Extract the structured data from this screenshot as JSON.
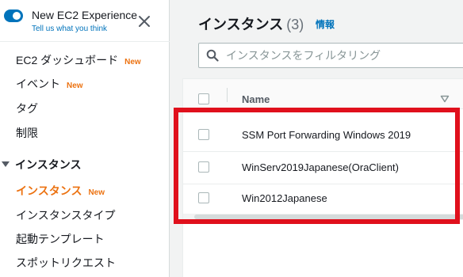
{
  "experience": {
    "title": "New EC2 Experience",
    "link": "Tell us what you think"
  },
  "sidebar": {
    "items": [
      {
        "label": "EC2 ダッシュボード",
        "badge": "New"
      },
      {
        "label": "イベント",
        "badge": "New"
      },
      {
        "label": "タグ",
        "badge": ""
      },
      {
        "label": "制限",
        "badge": ""
      }
    ],
    "section": {
      "label": "インスタンス",
      "items": [
        {
          "label": "インスタンス",
          "badge": "New",
          "active": true
        },
        {
          "label": "インスタンスタイプ",
          "badge": ""
        },
        {
          "label": "起動テンプレート",
          "badge": ""
        },
        {
          "label": "スポットリクエスト",
          "badge": ""
        }
      ]
    }
  },
  "main": {
    "title": "インスタンス",
    "count": "(3)",
    "info": "情報",
    "search_placeholder": "インスタンスをフィルタリング",
    "table": {
      "column": "Name",
      "rows": [
        {
          "name": "SSM Port Forwarding Windows 2019"
        },
        {
          "name": "WinServ2019Japanese(OraClient)"
        },
        {
          "name": "Win2012Japanese"
        }
      ]
    }
  },
  "colors": {
    "accent": "#0073bb",
    "new_badge": "#ec7211",
    "highlight": "#e0101c"
  }
}
